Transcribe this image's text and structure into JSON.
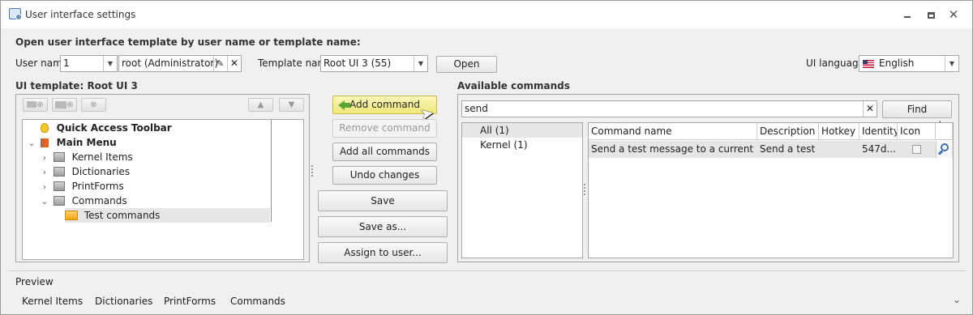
{
  "window": {
    "title": "User interface settings"
  },
  "open_section": {
    "heading": "Open user interface template by user name or template name:"
  },
  "user_name": {
    "label": "User name",
    "id_value": "1",
    "name_value": "root (Administrator)"
  },
  "template": {
    "label": "Template name",
    "value": "Root UI 3 (55)",
    "open_label": "Open"
  },
  "ui_language": {
    "label": "UI language:",
    "value": "English"
  },
  "ui_template": {
    "heading": "UI template:",
    "name": "Root UI 3"
  },
  "tree": [
    {
      "label": "Quick Access Toolbar",
      "bold": true
    },
    {
      "label": "Main Menu",
      "bold": true
    },
    {
      "label": "Kernel Items"
    },
    {
      "label": "Dictionaries"
    },
    {
      "label": "PrintForms"
    },
    {
      "label": "Commands"
    },
    {
      "label": "Test commands"
    }
  ],
  "actions": {
    "add_command": "Add command",
    "remove_command": "Remove command",
    "add_all_commands": "Add all commands",
    "undo_changes": "Undo changes",
    "save": "Save",
    "save_as": "Save as...",
    "assign_to_user": "Assign to user..."
  },
  "available": {
    "heading": "Available commands",
    "search_value": "send",
    "find_label": "Find command",
    "groups": [
      "All (1)",
      "Kernel (1)"
    ],
    "columns": [
      "Command name",
      "Description",
      "Hotkey",
      "Identity",
      "Icon"
    ],
    "rows": [
      {
        "name": "Send a test message to a current user",
        "description": "Send a test ...",
        "hotkey": "",
        "identity": "547d..."
      }
    ]
  },
  "preview": {
    "label": "Preview",
    "tabs": [
      "Kernel Items",
      "Dictionaries",
      "PrintForms",
      "Commands"
    ]
  },
  "colors": {
    "add_command_bg": "#f7f2a0",
    "selected_row": "#e6e6e6",
    "arrow_green": "#5aa832"
  }
}
